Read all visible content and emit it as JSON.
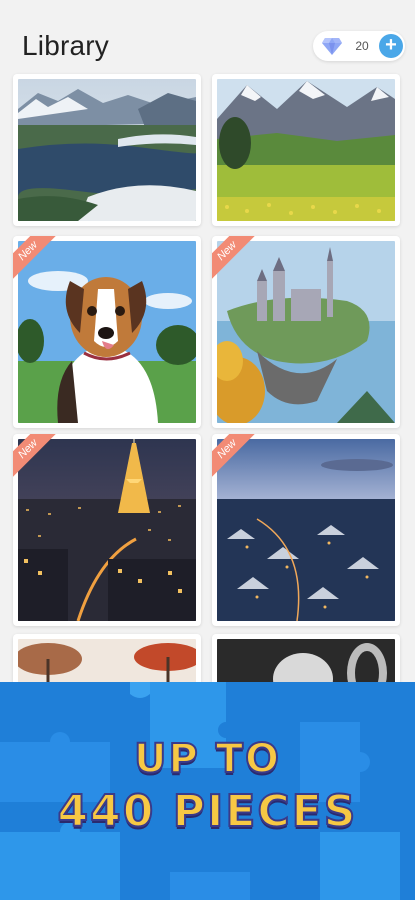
{
  "header": {
    "title": "Library",
    "gem_count": "20",
    "gem_icon": "diamond-icon",
    "plus_icon": "plus-icon"
  },
  "tiles": [
    {
      "name": "tile-mountain-lake",
      "new": false,
      "badge": ""
    },
    {
      "name": "tile-alpine-meadow",
      "new": false,
      "badge": ""
    },
    {
      "name": "tile-dog",
      "new": true,
      "badge": "New"
    },
    {
      "name": "tile-floating-castle",
      "new": true,
      "badge": "New"
    },
    {
      "name": "tile-eiffel-tower-night",
      "new": true,
      "badge": "New"
    },
    {
      "name": "tile-snowy-town-dusk",
      "new": true,
      "badge": "New"
    },
    {
      "name": "tile-autumn-trees",
      "new": false,
      "badge": ""
    },
    {
      "name": "tile-dark-figure",
      "new": false,
      "badge": ""
    }
  ],
  "banner": {
    "line1": "UP TO",
    "line2": "440 PIECES"
  },
  "colors": {
    "background": "#f2f2f2",
    "accent": "#4aa7e8",
    "badge": "#f28b75",
    "banner_blue": "#1f7fd8",
    "banner_text": "#f7c844"
  }
}
